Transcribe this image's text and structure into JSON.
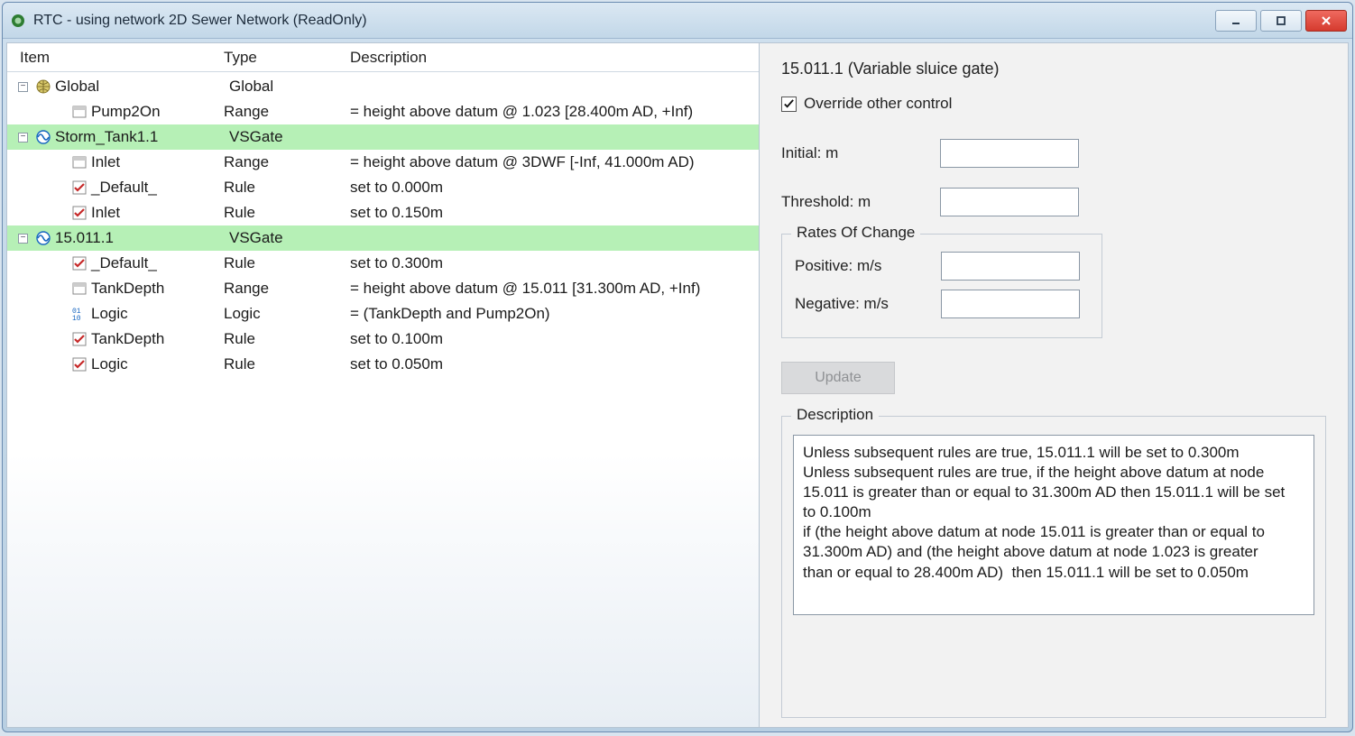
{
  "window": {
    "title": "RTC -  using network 2D Sewer Network (ReadOnly)"
  },
  "columns": {
    "item": "Item",
    "type": "Type",
    "description": "Description"
  },
  "tree": [
    {
      "indent": 0,
      "expander": "-",
      "icon": "globe",
      "name": "Global",
      "type": "Global",
      "desc": "",
      "highlight": false
    },
    {
      "indent": 2,
      "expander": "",
      "icon": "range",
      "name": "Pump2On",
      "type": "Range",
      "desc": "= height above datum @ 1.023 [28.400m AD, +Inf)",
      "highlight": false
    },
    {
      "indent": 0,
      "expander": "-",
      "icon": "gate",
      "name": "Storm_Tank1.1",
      "type": "VSGate",
      "desc": "",
      "highlight": true
    },
    {
      "indent": 2,
      "expander": "",
      "icon": "range",
      "name": "Inlet",
      "type": "Range",
      "desc": "= height above datum @ 3DWF [-Inf, 41.000m AD)",
      "highlight": false
    },
    {
      "indent": 2,
      "expander": "",
      "icon": "rule",
      "name": "_Default_",
      "type": "Rule",
      "desc": "set to 0.000m",
      "highlight": false
    },
    {
      "indent": 2,
      "expander": "",
      "icon": "rule",
      "name": "Inlet",
      "type": "Rule",
      "desc": "set to 0.150m",
      "highlight": false
    },
    {
      "indent": 0,
      "expander": "-",
      "icon": "gate",
      "name": "15.011.1",
      "type": "VSGate",
      "desc": "",
      "highlight": true
    },
    {
      "indent": 2,
      "expander": "",
      "icon": "rule",
      "name": "_Default_",
      "type": "Rule",
      "desc": "set to 0.300m",
      "highlight": false
    },
    {
      "indent": 2,
      "expander": "",
      "icon": "range",
      "name": "TankDepth",
      "type": "Range",
      "desc": "= height above datum @ 15.011 [31.300m AD, +Inf)",
      "highlight": false
    },
    {
      "indent": 2,
      "expander": "",
      "icon": "logic",
      "name": "Logic",
      "type": "Logic",
      "desc": "= (TankDepth and Pump2On)",
      "highlight": false
    },
    {
      "indent": 2,
      "expander": "",
      "icon": "rule",
      "name": "TankDepth",
      "type": "Rule",
      "desc": "set to 0.100m",
      "highlight": false
    },
    {
      "indent": 2,
      "expander": "",
      "icon": "rule",
      "name": "Logic",
      "type": "Rule",
      "desc": "set to 0.050m",
      "highlight": false
    }
  ],
  "right": {
    "title": "15.011.1 (Variable sluice gate)",
    "override_label": "Override other control",
    "override_checked": true,
    "initial_label": "Initial: m",
    "initial_value": "",
    "threshold_label": "Threshold: m",
    "threshold_value": "",
    "rates_legend": "Rates Of Change",
    "positive_label": "Positive: m/s",
    "positive_value": "",
    "negative_label": "Negative: m/s",
    "negative_value": "",
    "update_label": "Update",
    "desc_legend": "Description",
    "desc_text": "Unless subsequent rules are true, 15.011.1 will be set to 0.300m\nUnless subsequent rules are true, if the height above datum at node 15.011 is greater than or equal to 31.300m AD then 15.011.1 will be set to 0.100m\nif (the height above datum at node 15.011 is greater than or equal to 31.300m AD) and (the height above datum at node 1.023 is greater than or equal to 28.400m AD)  then 15.011.1 will be set to 0.050m"
  }
}
